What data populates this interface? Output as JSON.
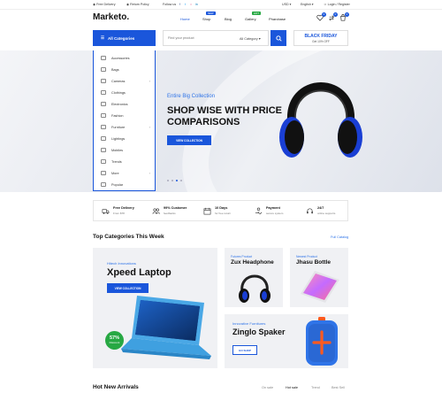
{
  "topbar": {
    "free_delivery": "Free Delivery",
    "return_policy": "Return Policy",
    "follow_us": "Follow us",
    "currency": "USD",
    "language": "English",
    "login": "Login / Register"
  },
  "brand": {
    "logo": "Marketo."
  },
  "nav": {
    "items": [
      {
        "label": "Home",
        "active": true
      },
      {
        "label": "Shop",
        "badge": "NEW"
      },
      {
        "label": "Blog"
      },
      {
        "label": "Gallery",
        "badge": "HOT"
      },
      {
        "label": "Pharcbase"
      }
    ]
  },
  "header_icons": {
    "wishlist_count": "0",
    "compare_count": "0",
    "cart_count": "0"
  },
  "search": {
    "all_categories": "All Categories",
    "placeholder": "Find your product",
    "category_select": "All Category"
  },
  "promo": {
    "title": "BLACK FRIDAY",
    "subtitle": "Get 10% OFF"
  },
  "categories": [
    "Accessories",
    "Bags",
    "Cameras",
    "Clothings",
    "Electronics",
    "Fashion",
    "Furniture",
    "Lightings",
    "Mobiles",
    "Trends",
    "More",
    "Popular"
  ],
  "hero": {
    "eyebrow": "Entire Big Collection",
    "headline": "SHOP WISE WITH PRICE COMPARISONS",
    "button": "VIEW COLLECTION"
  },
  "features": [
    {
      "title": "Free Delivery",
      "sub": "From $78"
    },
    {
      "title": "99% Customer",
      "sub": "feedbacks"
    },
    {
      "title": "10 Days",
      "sub": "for free return"
    },
    {
      "title": "Payment",
      "sub": "secure system"
    },
    {
      "title": "24/7",
      "sub": "online supports"
    }
  ],
  "top_categories": {
    "title": "Top Categories This Week",
    "full_catalog": "Full Catalog",
    "cards": [
      {
        "kicker": "Hitech Innovations",
        "name": "Xpeed Laptop",
        "button": "VIEW COLLECTION",
        "discount": "57%",
        "discount_label": "Discount"
      },
      {
        "kicker": "Futures Product",
        "name": "Zux Headphone"
      },
      {
        "kicker": "Newest Product",
        "name": "Jhasu Bottle"
      },
      {
        "kicker": "Innovative Furnitures",
        "name": "Zinglo Spaker",
        "button": "GO SHOP"
      }
    ]
  },
  "hot_new": {
    "title": "Hot New Arrivals",
    "tabs": [
      "On sale",
      "Hot sale",
      "Trend",
      "Best Sell"
    ]
  },
  "colors": {
    "accent": "#1a56db",
    "discount": "#27a843",
    "speaker": "#2f74e8"
  }
}
